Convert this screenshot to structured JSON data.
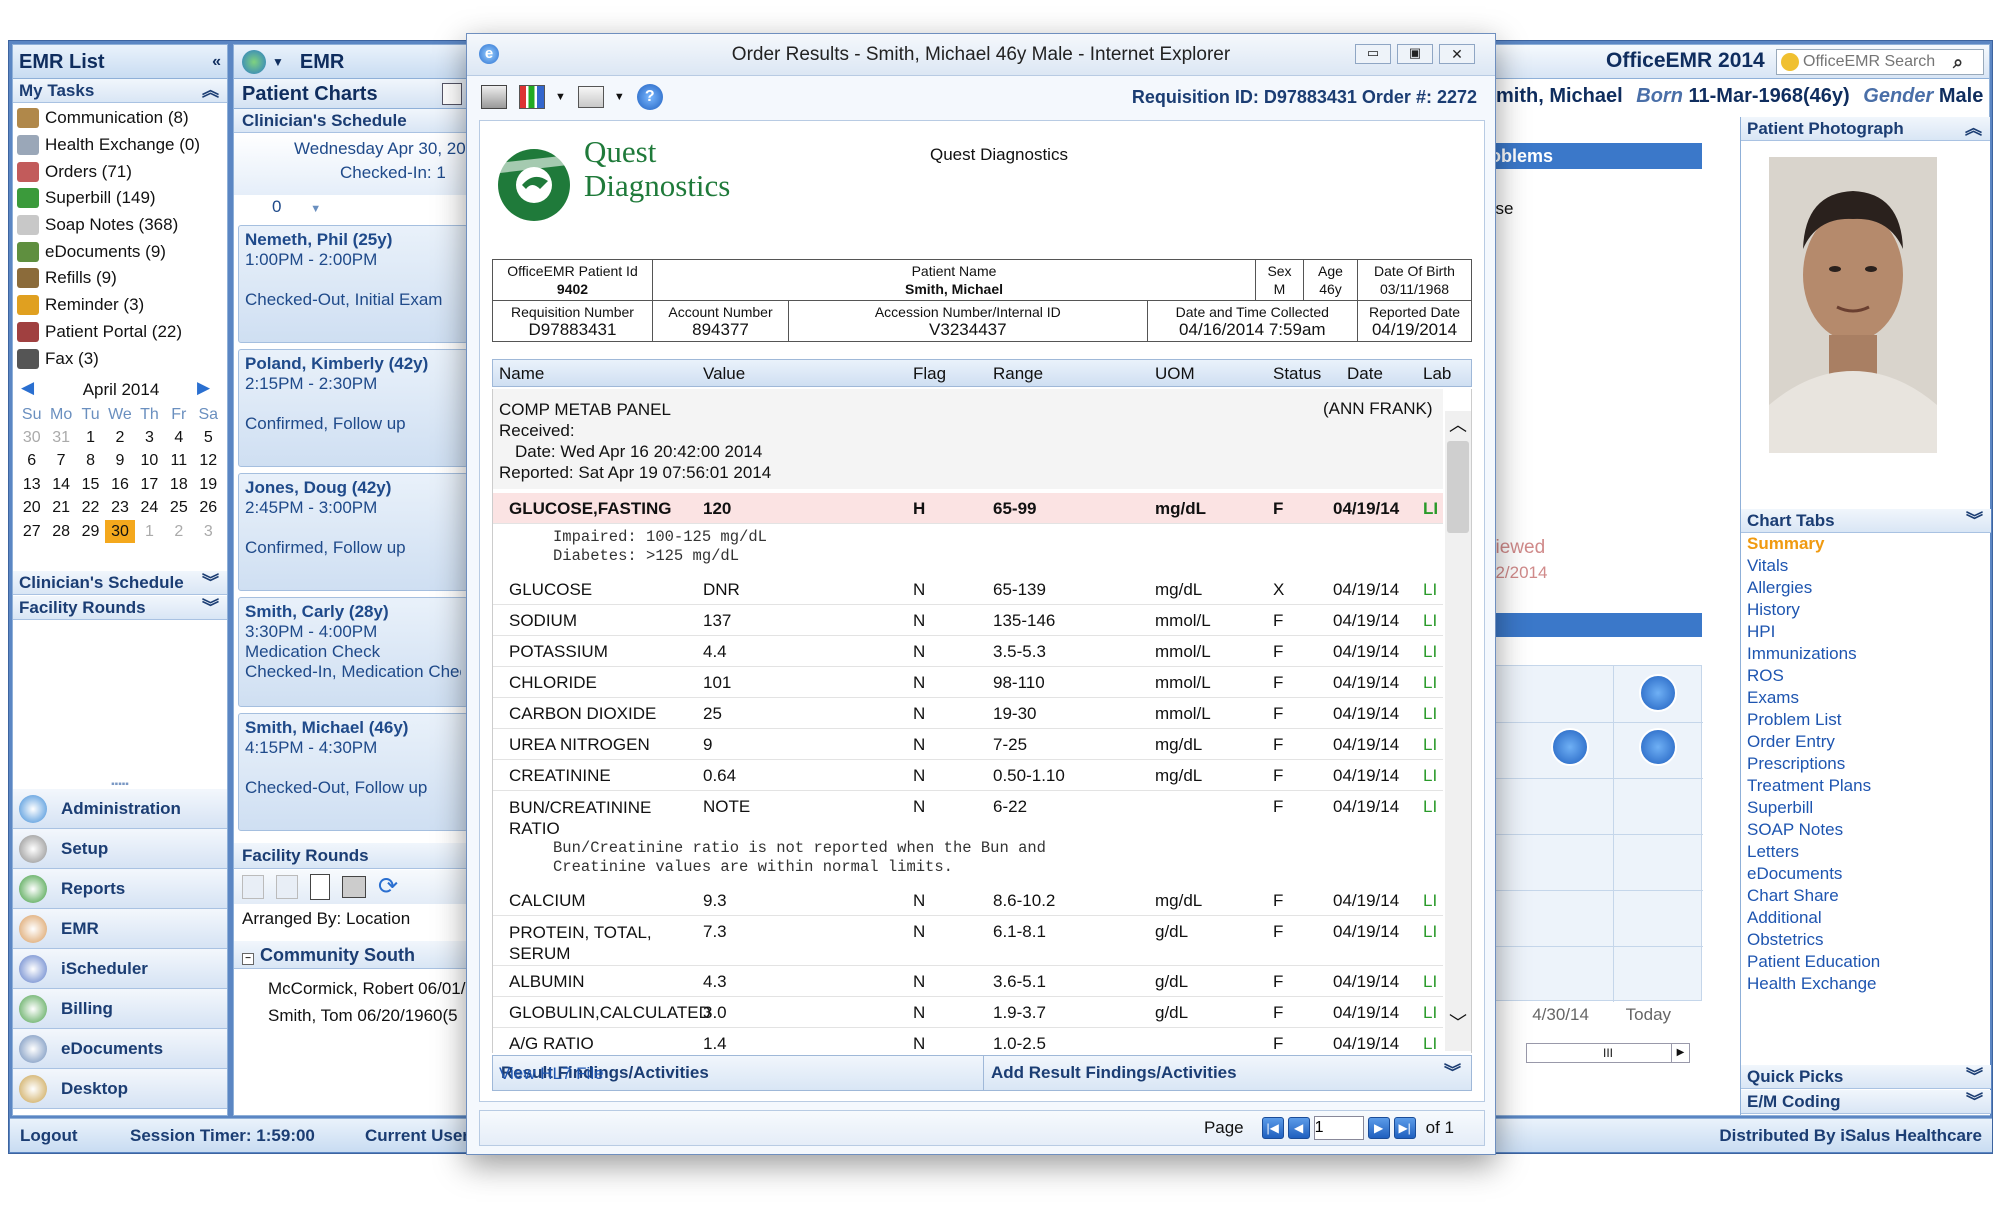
{
  "app": {
    "title": "OfficeEMR 2014",
    "search_placeholder": "OfficeEMR Search",
    "footer_left": "Logout",
    "session_timer": "Session Timer: 1:59:00",
    "current_user": "Current User",
    "distributed": "Distributed By iSalus Healthcare"
  },
  "left": {
    "title": "EMR List",
    "my_tasks": "My Tasks",
    "tasks": [
      {
        "label": "Communication (8)",
        "color": "#b0884a"
      },
      {
        "label": "Health Exchange (0)",
        "color": "#9aa7b8"
      },
      {
        "label": "Orders (71)",
        "color": "#c25b5b"
      },
      {
        "label": "Superbill (149)",
        "color": "#3b9a3b"
      },
      {
        "label": "Soap Notes (368)",
        "color": "#c8c8c8"
      },
      {
        "label": "eDocuments (9)",
        "color": "#5f8f3f"
      },
      {
        "label": "Refills (9)",
        "color": "#8b6b3a"
      },
      {
        "label": "Reminder (3)",
        "color": "#e0a020"
      },
      {
        "label": "Patient Portal (22)",
        "color": "#a04040"
      },
      {
        "label": "Fax (3)",
        "color": "#555555"
      }
    ],
    "calendar": {
      "month": "April 2014",
      "days": [
        "Su",
        "Mo",
        "Tu",
        "We",
        "Th",
        "Fr",
        "Sa"
      ],
      "weeks": [
        [
          "30",
          "31",
          "1",
          "2",
          "3",
          "4",
          "5"
        ],
        [
          "6",
          "7",
          "8",
          "9",
          "10",
          "11",
          "12"
        ],
        [
          "13",
          "14",
          "15",
          "16",
          "17",
          "18",
          "19"
        ],
        [
          "20",
          "21",
          "22",
          "23",
          "24",
          "25",
          "26"
        ],
        [
          "27",
          "28",
          "29",
          "30",
          "1",
          "2",
          "3"
        ]
      ]
    },
    "sections": [
      "Clinician's Schedule",
      "Facility Rounds"
    ],
    "nav": [
      {
        "label": "Administration",
        "color": "#3a8ad8"
      },
      {
        "label": "Setup",
        "color": "#8a8a8a"
      },
      {
        "label": "Reports",
        "color": "#3a9a3a"
      },
      {
        "label": "EMR",
        "color": "#d89a5a"
      },
      {
        "label": "iScheduler",
        "color": "#5a7ac8"
      },
      {
        "label": "Billing",
        "color": "#4aa04a"
      },
      {
        "label": "eDocuments",
        "color": "#6a8ab8"
      },
      {
        "label": "Desktop",
        "color": "#c8a04a"
      }
    ]
  },
  "mid": {
    "title": "EMR",
    "patient_charts": "Patient Charts",
    "schedule": "Clinician's Schedule",
    "date": "Wednesday Apr 30, 20",
    "checked_in": "Checked-In: 1",
    "count": "0",
    "appointments": [
      {
        "name": "Nemeth, Phil (25y)",
        "time": "1:00PM - 2:00PM",
        "l3": "",
        "l4": "Checked-Out, Initial Exam"
      },
      {
        "name": "Poland, Kimberly (42y)",
        "time": "2:15PM - 2:30PM",
        "l3": "",
        "l4": "Confirmed, Follow up"
      },
      {
        "name": "Jones, Doug (42y)",
        "time": "2:45PM - 3:00PM",
        "l3": "",
        "l4": "Confirmed, Follow up"
      },
      {
        "name": "Smith, Carly (28y)",
        "time": "3:30PM - 4:00PM",
        "l3": "Medication Check",
        "l4": "Checked-In, Medication Chec"
      },
      {
        "name": "Smith, Michael (46y)",
        "time": "4:15PM - 4:30PM",
        "l3": "",
        "l4": "Checked-Out, Follow up"
      }
    ],
    "facility": "Facility Rounds",
    "arranged": "Arranged By: Location",
    "community": "Community South",
    "rounds": [
      "McCormick, Robert 06/01/",
      "Smith, Tom 06/20/1960(5"
    ]
  },
  "right": {
    "patient_prefix": "mith, Michael",
    "born_label": "Born",
    "born": "11-Mar-1968(46y)",
    "gender_label": "Gender",
    "gender": "Male",
    "problems": "oblems",
    "ase": "ase",
    "viewed": "viewed",
    "viewed_date": "02/2014",
    "photo_title": "Patient Photograph",
    "chart_tabs": "Chart Tabs",
    "tabs": [
      "Summary",
      "Vitals",
      "Allergies",
      "History",
      "HPI",
      "Immunizations",
      "ROS",
      "Exams",
      "Problem List",
      "Order Entry",
      "Prescriptions",
      "Treatment Plans",
      "Superbill",
      "SOAP Notes",
      "Letters",
      "eDocuments",
      "Chart Share",
      "Additional",
      "Obstetrics",
      "Patient Education",
      "Health Exchange"
    ],
    "quick_picks": "Quick Picks",
    "em_coding": "E/M Coding",
    "timeline_dates": [
      "4",
      "4/30/14",
      "Today"
    ],
    "scroll_thumb": "III"
  },
  "dialog": {
    "title": "Order Results - Smith, Michael 46y Male - Internet Explorer",
    "requisition": "Requisition ID: D97883431 Order #: 2272",
    "lab_name": "Quest Diagnostics",
    "logo_l1": "Quest",
    "logo_l2": "Diagnostics",
    "info": {
      "pid_label": "OfficeEMR Patient Id",
      "pid": "9402",
      "name_label": "Patient Name",
      "name": "Smith, Michael",
      "sex_label": "Sex",
      "sex": "M",
      "age_label": "Age",
      "age": "46y",
      "dob_label": "Date Of Birth",
      "dob": "03/11/1968",
      "req_label": "Requisition Number",
      "req": "D97883431",
      "acct_label": "Account Number",
      "acct": "894377",
      "acc_label": "Accession Number/Internal ID",
      "acc": "V3234437",
      "coll_label": "Date and Time Collected",
      "coll": "04/16/2014 7:59am",
      "rep_label": "Reported Date",
      "rep": "04/19/2014"
    },
    "columns": [
      "Name",
      "Value",
      "Flag",
      "Range",
      "UOM",
      "Status",
      "Date",
      "Lab"
    ],
    "panel": {
      "name": "COMP METAB PANEL",
      "doctor": "(ANN FRANK)",
      "received": "Received:",
      "date": "Date: Wed Apr 16 20:42:00 2014",
      "reported": "Reported: Sat Apr 19 07:56:01 2014"
    },
    "highlight": {
      "name": "GLUCOSE,FASTING",
      "value": "120",
      "flag": "H",
      "range": "65-99",
      "uom": "mg/dL",
      "status": "F",
      "date": "04/19/14",
      "lab": "LI",
      "note1": "Impaired: 100-125 mg/dL",
      "note2": "Diabetes: >125 mg/dL"
    },
    "results": [
      [
        "GLUCOSE",
        "DNR",
        "N",
        "65-139",
        "mg/dL",
        "X",
        "04/19/14",
        "LI"
      ],
      [
        "SODIUM",
        "137",
        "N",
        "135-146",
        "mmol/L",
        "F",
        "04/19/14",
        "LI"
      ],
      [
        "POTASSIUM",
        "4.4",
        "N",
        "3.5-5.3",
        "mmol/L",
        "F",
        "04/19/14",
        "LI"
      ],
      [
        "CHLORIDE",
        "101",
        "N",
        "98-110",
        "mmol/L",
        "F",
        "04/19/14",
        "LI"
      ],
      [
        "CARBON DIOXIDE",
        "25",
        "N",
        "19-30",
        "mmol/L",
        "F",
        "04/19/14",
        "LI"
      ],
      [
        "UREA NITROGEN",
        "9",
        "N",
        "7-25",
        "mg/dL",
        "F",
        "04/19/14",
        "LI"
      ],
      [
        "CREATININE",
        "0.64",
        "N",
        "0.50-1.10",
        "mg/dL",
        "F",
        "04/19/14",
        "LI"
      ]
    ],
    "bun": {
      "name1": "BUN/CREATININE",
      "name2": "RATIO",
      "value": "NOTE",
      "flag": "N",
      "range": "6-22",
      "status": "F",
      "date": "04/19/14",
      "lab": "LI",
      "note1": "Bun/Creatinine ratio is not reported when the Bun and",
      "note2": "Creatinine values are within normal limits."
    },
    "results2": [
      [
        "CALCIUM",
        "9.3",
        "N",
        "8.6-10.2",
        "mg/dL",
        "F",
        "04/19/14",
        "LI"
      ]
    ],
    "protein": {
      "name1": "PROTEIN, TOTAL,",
      "name2": "SERUM",
      "value": "7.3",
      "flag": "N",
      "range": "6.1-8.1",
      "uom": "g/dL",
      "status": "F",
      "date": "04/19/14",
      "lab": "LI"
    },
    "results3": [
      [
        "ALBUMIN",
        "4.3",
        "N",
        "3.6-5.1",
        "g/dL",
        "F",
        "04/19/14",
        "LI"
      ],
      [
        "GLOBULIN,CALCULATED",
        "3.0",
        "N",
        "1.9-3.7",
        "g/dL",
        "F",
        "04/19/14",
        "LI"
      ],
      [
        "A/G RATIO",
        "1.4",
        "N",
        "1.0-2.5",
        "",
        "F",
        "04/19/14",
        "LI"
      ]
    ],
    "findings": "Result Findings/Activities",
    "add_findings": "Add Result Findings/Activities",
    "hl7": "View HL7 File",
    "page_label": "Page",
    "page": "1",
    "of": "of 1"
  }
}
